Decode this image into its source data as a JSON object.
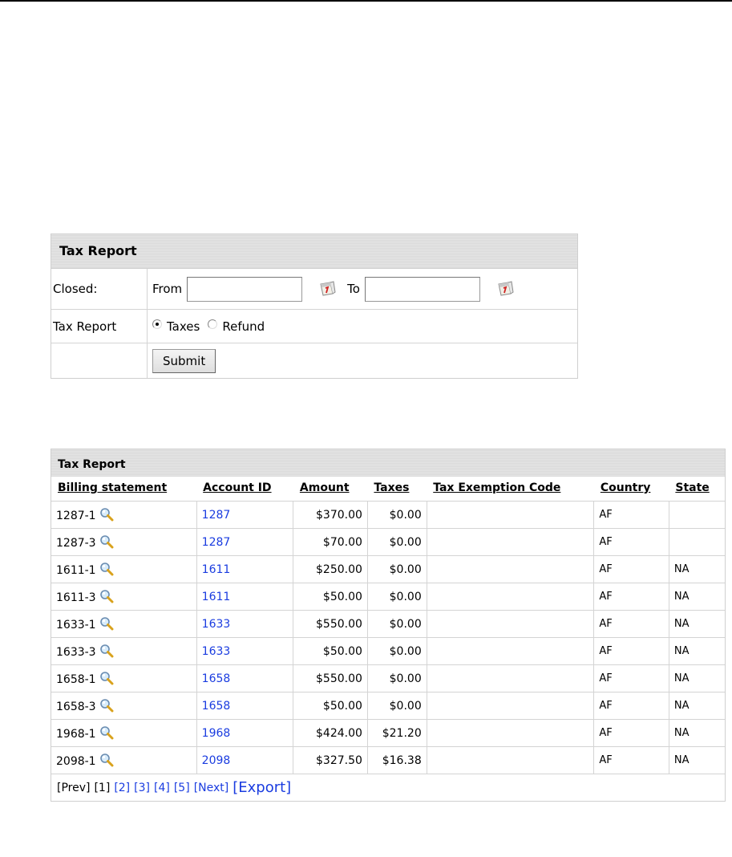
{
  "form": {
    "title": "Tax Report",
    "closed_label": "Closed:",
    "from_label": "From",
    "to_label": "To",
    "from_value": "",
    "to_value": "",
    "type_label": "Tax Report",
    "options": [
      "Taxes",
      "Refund"
    ],
    "selected_option": "Taxes",
    "submit_label": "Submit"
  },
  "results": {
    "title": "Tax Report",
    "columns": [
      "Billing statement",
      "Account ID",
      "Amount",
      "Taxes",
      "Tax Exemption Code",
      "Country",
      "State"
    ],
    "rows": [
      {
        "statement": "1287-1",
        "account": "1287",
        "amount": "$370.00",
        "taxes": "$0.00",
        "exemption": "",
        "country": "AF",
        "state": ""
      },
      {
        "statement": "1287-3",
        "account": "1287",
        "amount": "$70.00",
        "taxes": "$0.00",
        "exemption": "",
        "country": "AF",
        "state": ""
      },
      {
        "statement": "1611-1",
        "account": "1611",
        "amount": "$250.00",
        "taxes": "$0.00",
        "exemption": "",
        "country": "AF",
        "state": "NA"
      },
      {
        "statement": "1611-3",
        "account": "1611",
        "amount": "$50.00",
        "taxes": "$0.00",
        "exemption": "",
        "country": "AF",
        "state": "NA"
      },
      {
        "statement": "1633-1",
        "account": "1633",
        "amount": "$550.00",
        "taxes": "$0.00",
        "exemption": "",
        "country": "AF",
        "state": "NA"
      },
      {
        "statement": "1633-3",
        "account": "1633",
        "amount": "$50.00",
        "taxes": "$0.00",
        "exemption": "",
        "country": "AF",
        "state": "NA"
      },
      {
        "statement": "1658-1",
        "account": "1658",
        "amount": "$550.00",
        "taxes": "$0.00",
        "exemption": "",
        "country": "AF",
        "state": "NA"
      },
      {
        "statement": "1658-3",
        "account": "1658",
        "amount": "$50.00",
        "taxes": "$0.00",
        "exemption": "",
        "country": "AF",
        "state": "NA"
      },
      {
        "statement": "1968-1",
        "account": "1968",
        "amount": "$424.00",
        "taxes": "$21.20",
        "exemption": "",
        "country": "AF",
        "state": "NA"
      },
      {
        "statement": "2098-1",
        "account": "2098",
        "amount": "$327.50",
        "taxes": "$16.38",
        "exemption": "",
        "country": "AF",
        "state": "NA"
      }
    ],
    "pager": {
      "prev": "[Prev]",
      "current": "[1]",
      "pages": [
        "[2]",
        "[3]",
        "[4]",
        "[5]"
      ],
      "next": "[Next]",
      "export": "[Export]"
    }
  },
  "icons": {
    "calendar": "calendar-icon",
    "view": "magnifier-icon"
  },
  "colors": {
    "link": "#1a3ce0",
    "header_bg": "#dedede",
    "border": "#d4d4d4"
  }
}
